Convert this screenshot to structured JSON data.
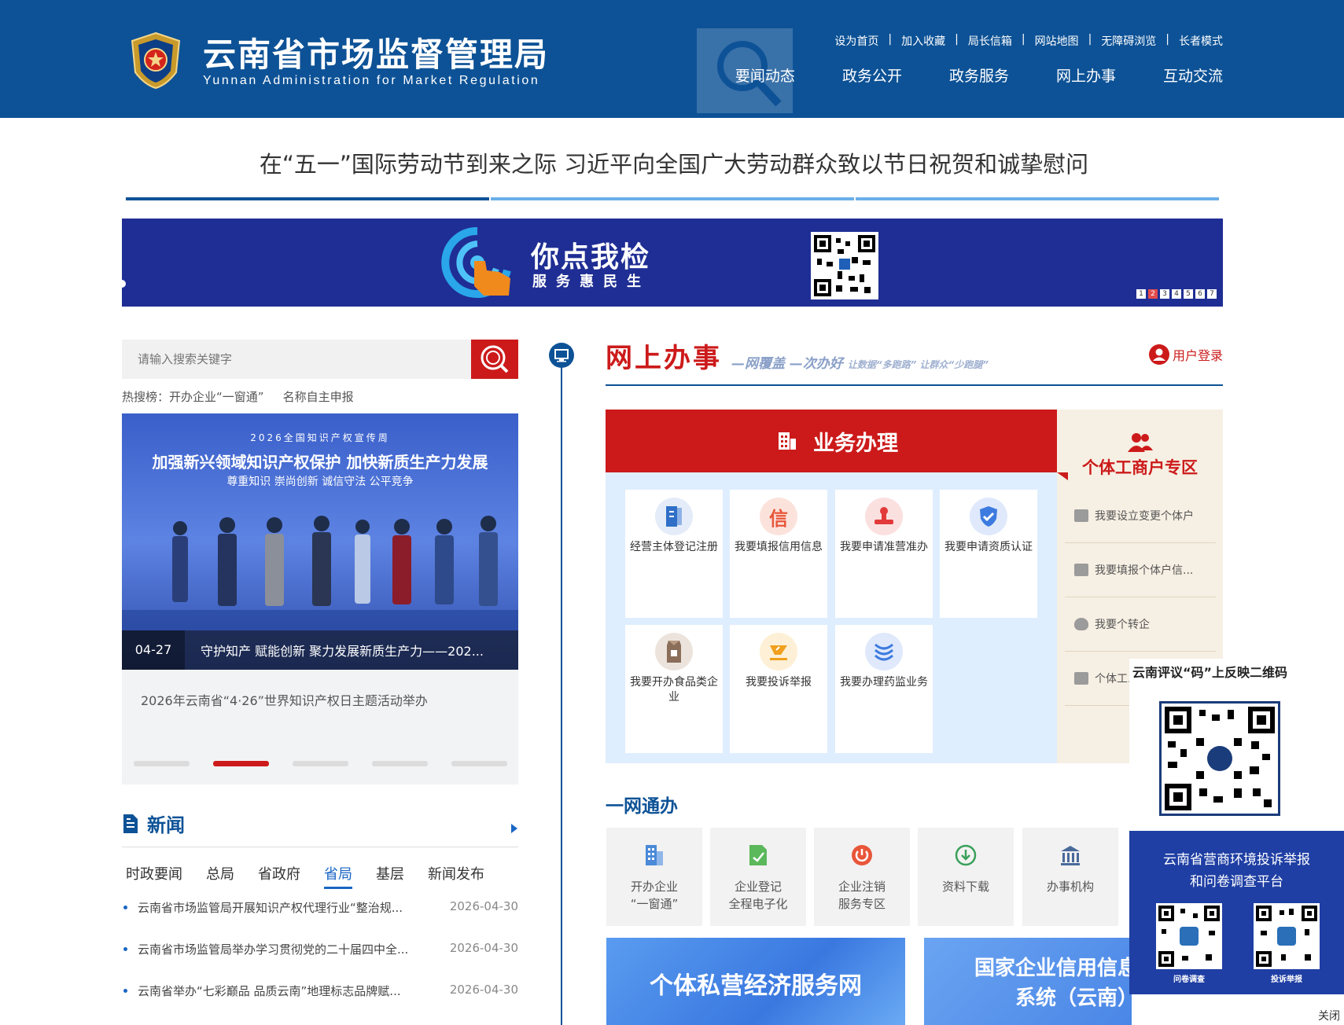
{
  "header": {
    "title": "云南省市场监督管理局",
    "subtitle": "Yunnan Administration for Market Regulation",
    "top_links": [
      "设为首页",
      "加入收藏",
      "局长信箱",
      "网站地图",
      "无障碍浏览",
      "长者模式"
    ],
    "nav": [
      "要闻动态",
      "政务公开",
      "政务服务",
      "网上办事",
      "互动交流"
    ]
  },
  "headline": "在“五一”国际劳动节到来之际 习近平向全国广大劳动群众致以节日祝贺和诚挚慰问",
  "banner": {
    "title": "你点我检",
    "subtitle": "服务惠民生",
    "dots": [
      "1",
      "2",
      "3",
      "4",
      "5",
      "6",
      "7"
    ],
    "active_dot": 2
  },
  "search": {
    "placeholder": "请输入搜索关键字",
    "hot_label": "热搜榜：",
    "hot_items": [
      "开办企业“一窗通”",
      "名称自主申报"
    ]
  },
  "carousel": {
    "img_top": "2026全国知识产权宣传周",
    "img_main": "加强新兴领域知识产权保护 加快新质生产力发展",
    "img_sub": "尊重知识 崇尚创新 诚信守法 公平竞争",
    "date": "04-27",
    "caption": "守护知产 赋能创新 聚力发展新质生产力——202...",
    "desc": "2026年云南省“4·26”世界知识产权日主题活动举办",
    "indicator_count": 5,
    "active_index": 1
  },
  "news": {
    "title": "新闻",
    "tabs": [
      "时政要闻",
      "总局",
      "省政府",
      "省局",
      "基层",
      "新闻发布"
    ],
    "active_tab": 3,
    "items": [
      {
        "title": "云南省市场监管局开展知识产权代理行业“整治规...",
        "date": "2026-04-30"
      },
      {
        "title": "云南省市场监管局举办学习贯彻党的二十届四中全...",
        "date": "2026-04-30"
      },
      {
        "title": "云南省举办“七彩巅品 品质云南”地理标志品牌赋...",
        "date": "2026-04-30"
      }
    ]
  },
  "online_services": {
    "title": "网上办事",
    "slogan": "—网覆盖 —次办好",
    "slogan_small": "让数据“多跑路” 让群众“少跑腿”",
    "user_login": "用户登录",
    "business_title": "业务办理",
    "business_items": [
      {
        "label": "经营主体登记注册",
        "icon": "registration-icon",
        "color": "#2f6fc7"
      },
      {
        "label": "我要填报信用信息",
        "icon": "credit-icon",
        "color": "#e8563a"
      },
      {
        "label": "我要申请准营准办",
        "icon": "stamp-icon",
        "color": "#e23a3a"
      },
      {
        "label": "我要申请资质认证",
        "icon": "shield-check-icon",
        "color": "#3d7be0"
      },
      {
        "label": "我要开办食品类企业",
        "icon": "food-bag-icon",
        "color": "#8a6e5a"
      },
      {
        "label": "我要投诉举报",
        "icon": "complaint-icon",
        "color": "#f0a01e"
      },
      {
        "label": "我要办理药监业务",
        "icon": "drug-icon",
        "color": "#3d7be0"
      }
    ],
    "individual_title": "个体工商户专区",
    "individual_items": [
      "我要设立变更个体户",
      "我要填报个体户信...",
      "我要个转企",
      "个体工..."
    ]
  },
  "one_net": {
    "title": "一网通办",
    "items": [
      {
        "label": "开办企业\n“一窗通”",
        "line1": "开办企业",
        "line2": "“一窗通”",
        "icon": "building-icon",
        "color": "#4a8ad8"
      },
      {
        "label": "企业登记全程电子化",
        "line1": "企业登记",
        "line2": "全程电子化",
        "icon": "document-icon",
        "color": "#5bb85b"
      },
      {
        "label": "企业注销服务专区",
        "line1": "企业注销",
        "line2": "服务专区",
        "icon": "power-icon",
        "color": "#e8563a"
      },
      {
        "label": "资料下载",
        "line1": "资料下载",
        "line2": "",
        "icon": "download-icon",
        "color": "#3aa05a"
      },
      {
        "label": "办事机构",
        "line1": "办事机构",
        "line2": "",
        "icon": "institution-icon",
        "color": "#4a6a9a"
      }
    ],
    "promo_1": "个体私营经济服务网",
    "promo_2_line1": "国家企业信用信息",
    "promo_2_line2": "系统（云南）"
  },
  "floating": {
    "qr_title": "云南评议“码”上反映二维码",
    "platform_line1": "云南省营商环境投诉举报",
    "platform_line2": "和问卷调查平台",
    "qr_label_1": "问卷调查",
    "qr_label_2": "投诉举报",
    "close": "关闭"
  },
  "colors": {
    "header_blue": "#0d5296",
    "accent_red": "#cc1a1a",
    "banner_navy": "#1f2e94",
    "light_blue": "#dfeefe",
    "beige": "#f6efe3"
  }
}
